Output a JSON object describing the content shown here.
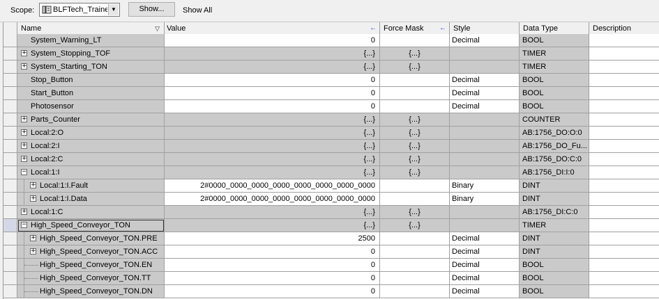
{
  "toolbar": {
    "scope_label": "Scope:",
    "scope_value": "BLFTech_Traine",
    "show_button": "Show...",
    "show_all_label": "Show All"
  },
  "columns": {
    "name": "Name",
    "value": "Value",
    "force_mask": "Force Mask",
    "style": "Style",
    "data_type": "Data Type",
    "description": "Description"
  },
  "rows": [
    {
      "name": "System_Warning_LT",
      "value": "0",
      "force": "",
      "style": "Decimal",
      "dtype": "BOOL",
      "expander": "",
      "level": 0
    },
    {
      "name": "System_Stopping_TOF",
      "value": "{...}",
      "force": "{...}",
      "style": "",
      "dtype": "TIMER",
      "expander": "+",
      "level": 0
    },
    {
      "name": "System_Starting_TON",
      "value": "{...}",
      "force": "{...}",
      "style": "",
      "dtype": "TIMER",
      "expander": "+",
      "level": 0
    },
    {
      "name": "Stop_Button",
      "value": "0",
      "force": "",
      "style": "Decimal",
      "dtype": "BOOL",
      "expander": "",
      "level": 0
    },
    {
      "name": "Start_Button",
      "value": "0",
      "force": "",
      "style": "Decimal",
      "dtype": "BOOL",
      "expander": "",
      "level": 0
    },
    {
      "name": "Photosensor",
      "value": "0",
      "force": "",
      "style": "Decimal",
      "dtype": "BOOL",
      "expander": "",
      "level": 0
    },
    {
      "name": "Parts_Counter",
      "value": "{...}",
      "force": "{...}",
      "style": "",
      "dtype": "COUNTER",
      "expander": "+",
      "level": 0
    },
    {
      "name": "Local:2:O",
      "value": "{...}",
      "force": "{...}",
      "style": "",
      "dtype": "AB:1756_DO:O:0",
      "expander": "+",
      "level": 0
    },
    {
      "name": "Local:2:I",
      "value": "{...}",
      "force": "{...}",
      "style": "",
      "dtype": "AB:1756_DO_Fu...",
      "expander": "+",
      "level": 0
    },
    {
      "name": "Local:2:C",
      "value": "{...}",
      "force": "{...}",
      "style": "",
      "dtype": "AB:1756_DO:C:0",
      "expander": "+",
      "level": 0
    },
    {
      "name": "Local:1:I",
      "value": "{...}",
      "force": "{...}",
      "style": "",
      "dtype": "AB:1756_DI:I:0",
      "expander": "−",
      "level": 0
    },
    {
      "name": "Local:1:I.Fault",
      "value": "2#0000_0000_0000_0000_0000_0000_0000_0000",
      "force": "",
      "style": "Binary",
      "dtype": "DINT",
      "expander": "+",
      "level": 1
    },
    {
      "name": "Local:1:I.Data",
      "value": "2#0000_0000_0000_0000_0000_0000_0000_0000",
      "force": "",
      "style": "Binary",
      "dtype": "DINT",
      "expander": "+",
      "level": 1
    },
    {
      "name": "Local:1:C",
      "value": "{...}",
      "force": "{...}",
      "style": "",
      "dtype": "AB:1756_DI:C:0",
      "expander": "+",
      "level": 0
    },
    {
      "name": "High_Speed_Conveyor_TON",
      "value": "{...}",
      "force": "{...}",
      "style": "",
      "dtype": "TIMER",
      "expander": "−",
      "level": 0
    },
    {
      "name": "High_Speed_Conveyor_TON.PRE",
      "value": "2500",
      "force": "",
      "style": "Decimal",
      "dtype": "DINT",
      "expander": "+",
      "level": 1
    },
    {
      "name": "High_Speed_Conveyor_TON.ACC",
      "value": "0",
      "force": "",
      "style": "Decimal",
      "dtype": "DINT",
      "expander": "+",
      "level": 1
    },
    {
      "name": "High_Speed_Conveyor_TON.EN",
      "value": "0",
      "force": "",
      "style": "Decimal",
      "dtype": "BOOL",
      "expander": "",
      "level": 1
    },
    {
      "name": "High_Speed_Conveyor_TON.TT",
      "value": "0",
      "force": "",
      "style": "Decimal",
      "dtype": "BOOL",
      "expander": "",
      "level": 1
    },
    {
      "name": "High_Speed_Conveyor_TON.DN",
      "value": "0",
      "force": "",
      "style": "Decimal",
      "dtype": "BOOL",
      "expander": "",
      "level": 1
    }
  ]
}
